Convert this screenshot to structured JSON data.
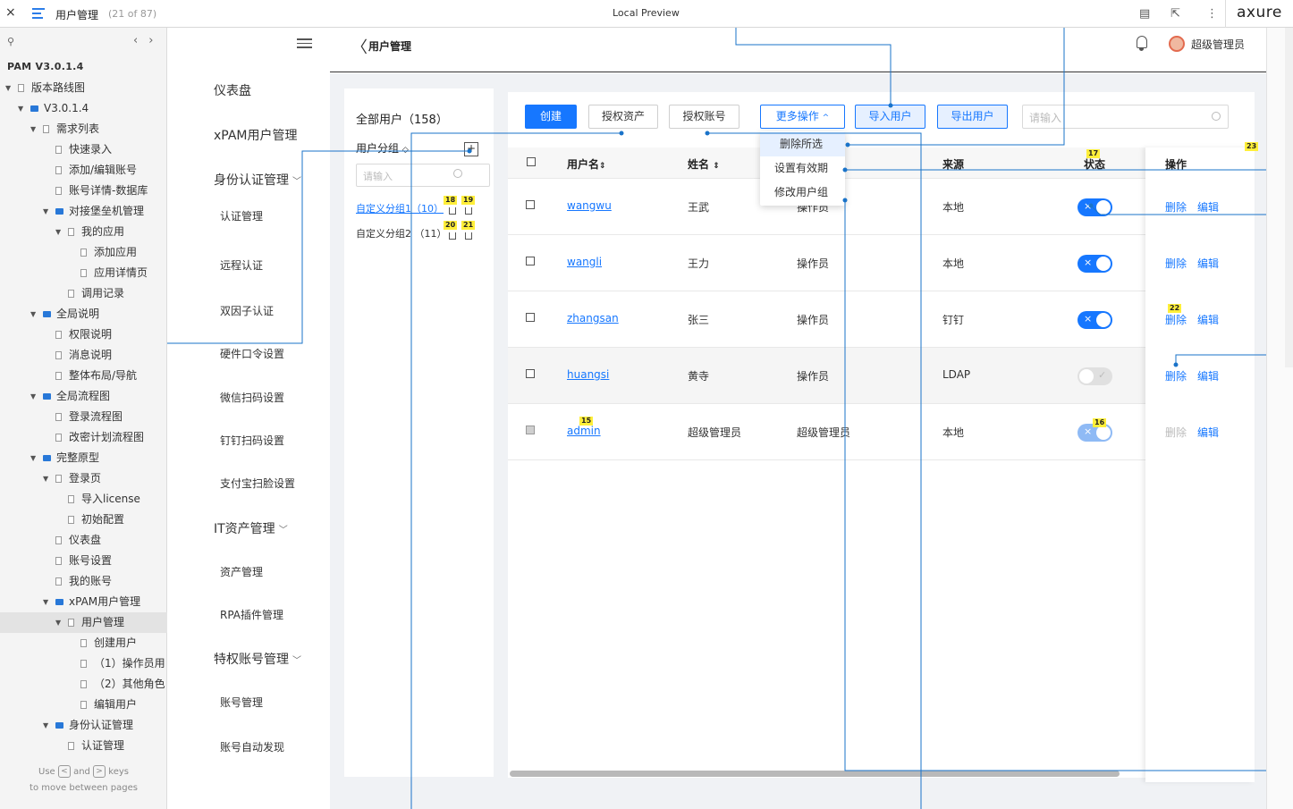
{
  "topbar": {
    "close_icon": "×",
    "page_name": "用户管理",
    "page_count": "(21 of 87)",
    "preview_label": "Local Preview",
    "brand": "axure"
  },
  "tree": {
    "project": "PAM V3.0.1.4",
    "items": [
      {
        "label": "版本路线图",
        "kind": "page",
        "depth": 0,
        "caret": "▼"
      },
      {
        "label": "V3.0.1.4",
        "kind": "folder",
        "depth": 1,
        "caret": "▼"
      },
      {
        "label": "需求列表",
        "kind": "page",
        "depth": 2,
        "caret": "▼"
      },
      {
        "label": "快速录入",
        "kind": "page",
        "depth": 3,
        "caret": ""
      },
      {
        "label": "添加/编辑账号",
        "kind": "page",
        "depth": 3,
        "caret": ""
      },
      {
        "label": "账号详情-数据库",
        "kind": "page",
        "depth": 3,
        "caret": ""
      },
      {
        "label": "对接堡垒机管理",
        "kind": "folder",
        "depth": 3,
        "caret": "▼"
      },
      {
        "label": "我的应用",
        "kind": "page",
        "depth": 4,
        "caret": "▼"
      },
      {
        "label": "添加应用",
        "kind": "page",
        "depth": 5,
        "caret": ""
      },
      {
        "label": "应用详情页",
        "kind": "page",
        "depth": 5,
        "caret": ""
      },
      {
        "label": "调用记录",
        "kind": "page",
        "depth": 4,
        "caret": ""
      },
      {
        "label": "全局说明",
        "kind": "folder",
        "depth": 2,
        "caret": "▼"
      },
      {
        "label": "权限说明",
        "kind": "page",
        "depth": 3,
        "caret": ""
      },
      {
        "label": "消息说明",
        "kind": "page",
        "depth": 3,
        "caret": ""
      },
      {
        "label": "整体布局/导航",
        "kind": "page",
        "depth": 3,
        "caret": ""
      },
      {
        "label": "全局流程图",
        "kind": "folder",
        "depth": 2,
        "caret": "▼"
      },
      {
        "label": "登录流程图",
        "kind": "page",
        "depth": 3,
        "caret": ""
      },
      {
        "label": "改密计划流程图",
        "kind": "page",
        "depth": 3,
        "caret": ""
      },
      {
        "label": "完整原型",
        "kind": "folder",
        "depth": 2,
        "caret": "▼"
      },
      {
        "label": "登录页",
        "kind": "page",
        "depth": 3,
        "caret": "▼"
      },
      {
        "label": "导入license",
        "kind": "page",
        "depth": 4,
        "caret": ""
      },
      {
        "label": "初始配置",
        "kind": "page",
        "depth": 4,
        "caret": ""
      },
      {
        "label": "仪表盘",
        "kind": "page",
        "depth": 3,
        "caret": ""
      },
      {
        "label": "账号设置",
        "kind": "page",
        "depth": 3,
        "caret": ""
      },
      {
        "label": "我的账号",
        "kind": "page",
        "depth": 3,
        "caret": ""
      },
      {
        "label": "xPAM用户管理",
        "kind": "folder",
        "depth": 3,
        "caret": "▼"
      },
      {
        "label": "用户管理",
        "kind": "page",
        "depth": 4,
        "caret": "▼",
        "selected": true
      },
      {
        "label": "创建用户",
        "kind": "page",
        "depth": 5,
        "caret": ""
      },
      {
        "label": "（1）操作员用",
        "kind": "page",
        "depth": 5,
        "caret": ""
      },
      {
        "label": "（2）其他角色",
        "kind": "page",
        "depth": 5,
        "caret": ""
      },
      {
        "label": "编辑用户",
        "kind": "page",
        "depth": 5,
        "caret": ""
      },
      {
        "label": "身份认证管理",
        "kind": "folder",
        "depth": 3,
        "caret": "▼"
      },
      {
        "label": "认证管理",
        "kind": "page",
        "depth": 4,
        "caret": ""
      }
    ],
    "hint_use": "Use",
    "hint_and": "and",
    "hint_keys": "keys",
    "hint_line2": "to move between pages",
    "key_prev": "<",
    "key_next": ">"
  },
  "appnav": {
    "items": [
      {
        "label": "仪表盘",
        "level": 1,
        "chev": ""
      },
      {
        "label": "xPAM用户管理",
        "level": 1,
        "chev": ""
      },
      {
        "label": "身份认证管理",
        "level": 1,
        "chev": "﹀"
      },
      {
        "label": "认证管理",
        "level": 2,
        "chev": ""
      },
      {
        "label": "远程认证",
        "level": 2,
        "chev": ""
      },
      {
        "label": "双因子认证",
        "level": 2,
        "chev": ""
      },
      {
        "label": "硬件口令设置",
        "level": 2,
        "chev": ""
      },
      {
        "label": "微信扫码设置",
        "level": 2,
        "chev": ""
      },
      {
        "label": "钉钉扫码设置",
        "level": 2,
        "chev": ""
      },
      {
        "label": "支付宝扫脸设置",
        "level": 2,
        "chev": ""
      },
      {
        "label": "IT资产管理",
        "level": 1,
        "chev": "﹀"
      },
      {
        "label": "资产管理",
        "level": 2,
        "chev": ""
      },
      {
        "label": "RPA插件管理",
        "level": 2,
        "chev": ""
      },
      {
        "label": "特权账号管理",
        "level": 1,
        "chev": "﹀"
      },
      {
        "label": "账号管理",
        "level": 2,
        "chev": ""
      },
      {
        "label": "账号自动发现",
        "level": 2,
        "chev": ""
      }
    ]
  },
  "header": {
    "back_icon": "〈",
    "title": "用户管理",
    "username": "超级管理员"
  },
  "groups": {
    "total": "全部用户（158）",
    "title": "用户分组",
    "title_icon": "◇",
    "add": "+",
    "search_placeholder": "请输入",
    "rows": [
      {
        "label": "自定义分组1（10）",
        "selected": true,
        "m1": "18",
        "m2": "19"
      },
      {
        "label": "自定义分组2 （11）",
        "selected": false,
        "m1": "20",
        "m2": "21"
      }
    ]
  },
  "toolbar": {
    "create": "创建",
    "auth_assets": "授权资产",
    "auth_accounts": "授权账号",
    "more_ops": "更多操作",
    "more_ops_caret": "^",
    "import_users": "导入用户",
    "export_users": "导出用户",
    "search_placeholder": "请输入"
  },
  "menu": {
    "items": [
      "删除所选",
      "设置有效期",
      "修改用户组"
    ]
  },
  "table": {
    "columns": {
      "username": "用户名",
      "name": "姓名",
      "source": "来源",
      "status": "状态",
      "ops": "操作",
      "sort_icon": "⇕"
    },
    "rows": [
      {
        "username": "wangwu",
        "name": "王武",
        "role": "操作员",
        "source": "本地",
        "status": "on",
        "delete": "删除",
        "edit": "编辑",
        "checkbox": "enabled"
      },
      {
        "username": "wangli",
        "name": "王力",
        "role": "操作员",
        "source": "本地",
        "status": "on",
        "delete": "删除",
        "edit": "编辑",
        "checkbox": "enabled"
      },
      {
        "username": "zhangsan",
        "name": "张三",
        "role": "操作员",
        "source": "钉钉",
        "status": "on",
        "delete": "删除",
        "edit": "编辑",
        "checkbox": "enabled"
      },
      {
        "username": "huangsi",
        "name": "黄寺",
        "role": "操作员",
        "source": "LDAP",
        "status": "off",
        "delete": "删除",
        "edit": "编辑",
        "checkbox": "enabled"
      },
      {
        "username": "admin",
        "name": "超级管理员",
        "role": "超级管理员",
        "source": "本地",
        "status": "on-disabled",
        "delete": "删除",
        "edit": "编辑",
        "checkbox": "disabled"
      }
    ]
  },
  "markers": {
    "m15": "15",
    "m16": "16",
    "m17": "17",
    "m22": "22",
    "m23": "23"
  },
  "colors": {
    "accent": "#1677ff",
    "annotation_line": "#1a73c9",
    "marker": "#ffef3a"
  }
}
